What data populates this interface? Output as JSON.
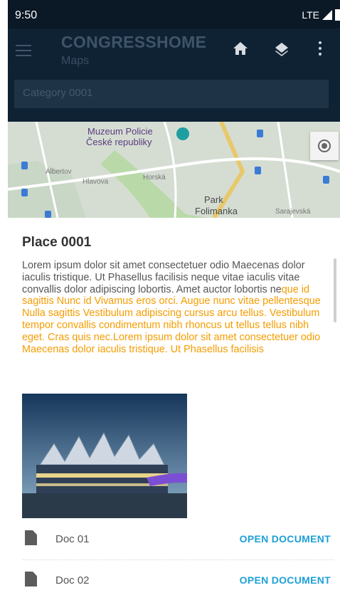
{
  "status_bar": {
    "time": "9:50",
    "network": "LTE"
  },
  "app_bar": {
    "title": "CONGRESSHOME",
    "subtitle": "Maps",
    "category": "Category 0001"
  },
  "map": {
    "labels": [
      "Muzeum Policie",
      "České republiky",
      "Albertov",
      "Hlavova",
      "Horská",
      "Park",
      "Folimanka",
      "Sarajevská"
    ]
  },
  "place": {
    "title": "Place 0001",
    "description_normal": "Lorem ipsum dolor sit amet consectetuer odio Maecenas dolor iaculis tristique. Ut Phasellus facilisis neque vitae iaculis vitae convallis dolor adipiscing lobortis. Amet auctor lobortis ne",
    "description_highlight": "que id sagittis Nunc id Vivamus eros orci. Augue nunc vitae pellentesque Nulla sagittis Vestibulum adipiscing cursus arcu tellus. Vestibulum tempor convallis condimentum nibh rhoncus ut tellus tellus nibh eget. Cras quis nec.Lorem ipsum dolor sit amet consectetuer odio Maecenas dolor iaculis tristique. Ut Phasellus facilisis"
  },
  "documents": [
    {
      "name": "Doc 01",
      "action": "OPEN DOCUMENT"
    },
    {
      "name": "Doc 02",
      "action": "OPEN DOCUMENT"
    }
  ],
  "colors": {
    "highlight": "#f59c00",
    "link": "#1ea0d8",
    "appbar": "#0f2234"
  },
  "icons": [
    "menu-icon",
    "home-icon",
    "layers-icon",
    "more-vert-icon",
    "my-location-icon",
    "document-icon"
  ]
}
